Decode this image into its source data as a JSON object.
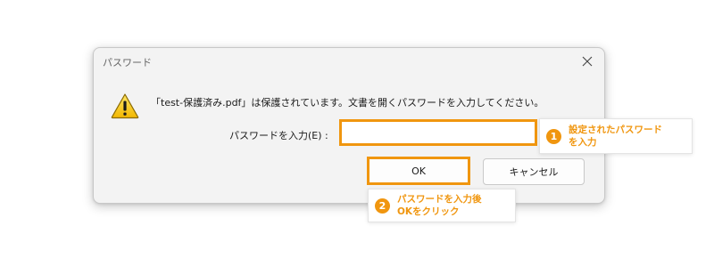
{
  "dialog": {
    "title": "パスワード",
    "message": "「test-保護済み.pdf」は保護されています。文書を開くパスワードを入力してください。",
    "password_label": "パスワードを入力(E) :",
    "password_value": "",
    "ok_label": "OK",
    "cancel_label": "キャンセル",
    "icons": {
      "warning": "warning-icon",
      "close": "close-icon"
    }
  },
  "callouts": [
    {
      "number": "1",
      "line1": "設定されたパスワード",
      "line2": "を入力"
    },
    {
      "number": "2",
      "line1": "パスワードを入力後",
      "line2": "OKをクリック"
    }
  ],
  "colors": {
    "highlight": "#f0960f",
    "dialog_bg": "#f3f3f3"
  }
}
